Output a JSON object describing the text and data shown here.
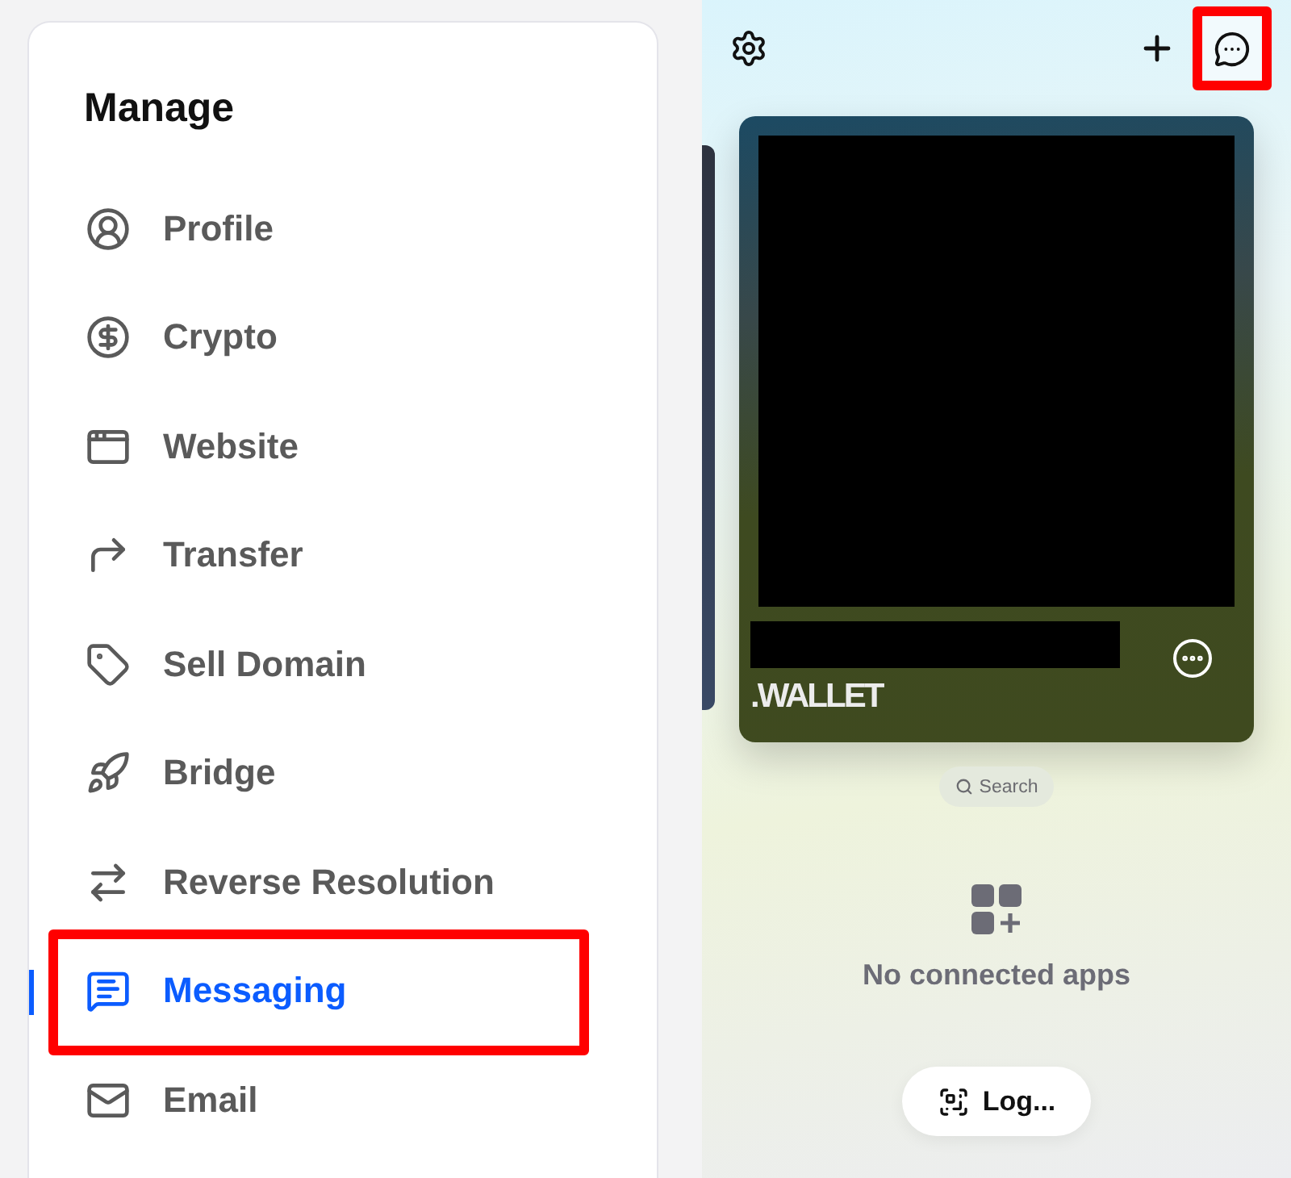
{
  "sidebar": {
    "title": "Manage",
    "items": [
      {
        "label": "Profile",
        "selected": false,
        "highlighted": false
      },
      {
        "label": "Crypto",
        "selected": false,
        "highlighted": false
      },
      {
        "label": "Website",
        "selected": false,
        "highlighted": false
      },
      {
        "label": "Transfer",
        "selected": false,
        "highlighted": false
      },
      {
        "label": "Sell Domain",
        "selected": false,
        "highlighted": false
      },
      {
        "label": "Bridge",
        "selected": false,
        "highlighted": false
      },
      {
        "label": "Reverse Resolution",
        "selected": false,
        "highlighted": false
      },
      {
        "label": "Messaging",
        "selected": true,
        "highlighted": true
      },
      {
        "label": "Email",
        "selected": false,
        "highlighted": false
      }
    ]
  },
  "wallet": {
    "toolbar": {
      "chat_highlighted": true
    },
    "card": {
      "domain_suffix": ".WALLET"
    },
    "search": {
      "label": "Search"
    },
    "empty_state": {
      "text": "No connected apps"
    },
    "login_button": {
      "label": "Log..."
    }
  }
}
